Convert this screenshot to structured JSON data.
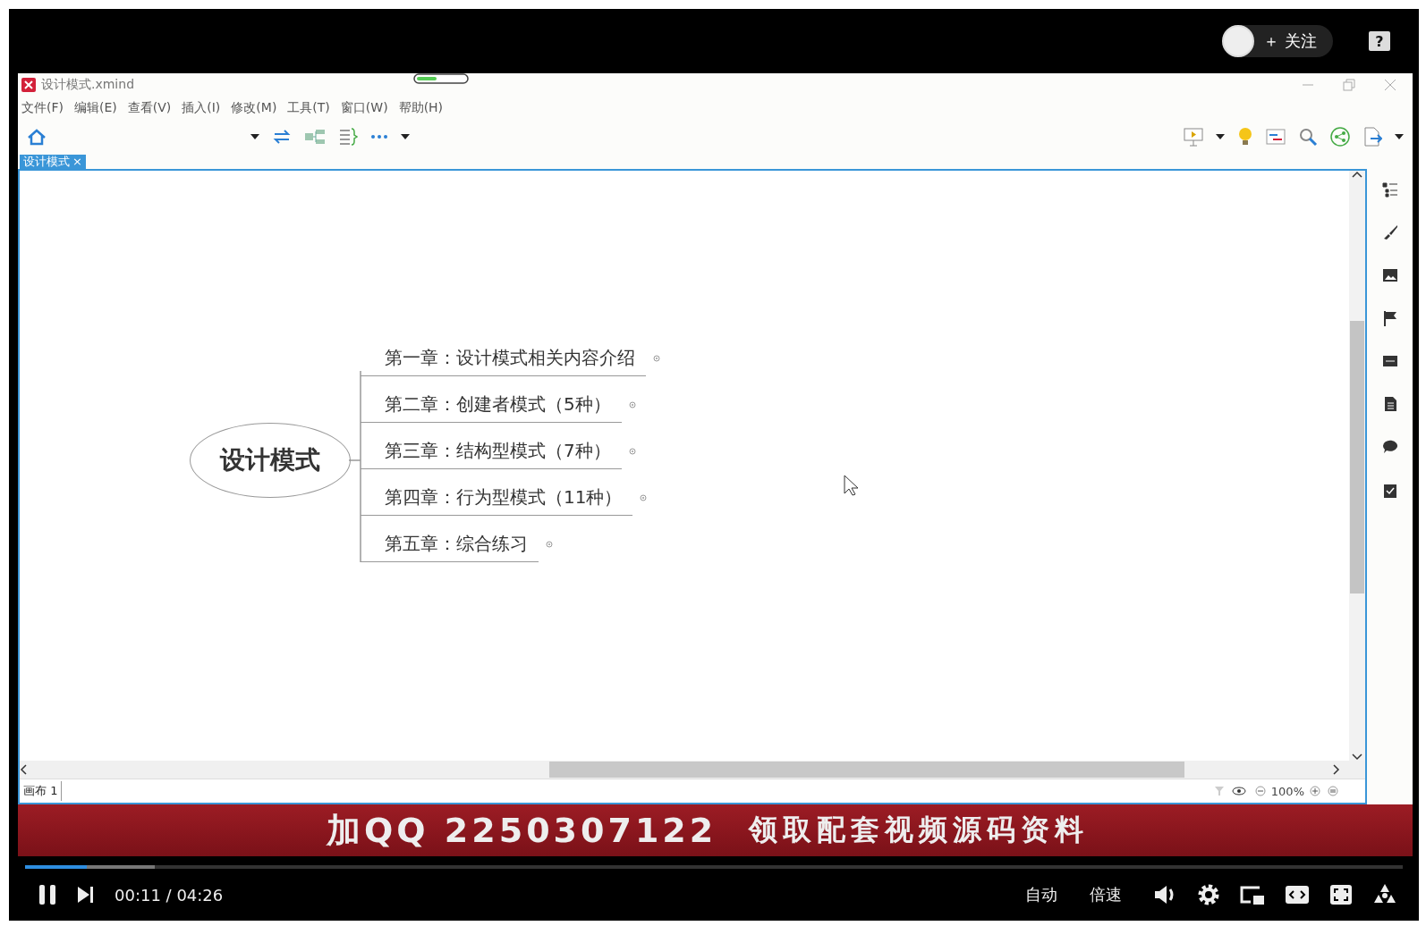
{
  "player_top": {
    "follow_button": "＋ 关注",
    "help": "?"
  },
  "window": {
    "title": "设计模式.xmind"
  },
  "menu": [
    "文件(F)",
    "编辑(E)",
    "查看(V)",
    "插入(I)",
    "修改(M)",
    "工具(T)",
    "窗口(W)",
    "帮助(H)"
  ],
  "tabs": [
    {
      "label": "设计模式",
      "close": "×",
      "selected": true
    }
  ],
  "mind_map": {
    "central": "设计模式",
    "topics": [
      {
        "label": "第一章：设计模式相关内容介绍"
      },
      {
        "label": "第二章：创建者模式（5种）"
      },
      {
        "label": "第三章：结构型模式（7种）"
      },
      {
        "label": "第四章：行为型模式（11种）"
      },
      {
        "label": "第五章：综合练习"
      }
    ]
  },
  "status_bar": {
    "sheet_tab": "画布 1",
    "zoom": "100%"
  },
  "banner": {
    "left": "加QQ 2250307122",
    "right": "领取配套视频源码资料"
  },
  "player": {
    "progress": {
      "level": 0.045
    },
    "buffer": {
      "level": 0.094
    },
    "time": "00:11 / 04:26",
    "quality": "自动",
    "speed": "倍速"
  }
}
